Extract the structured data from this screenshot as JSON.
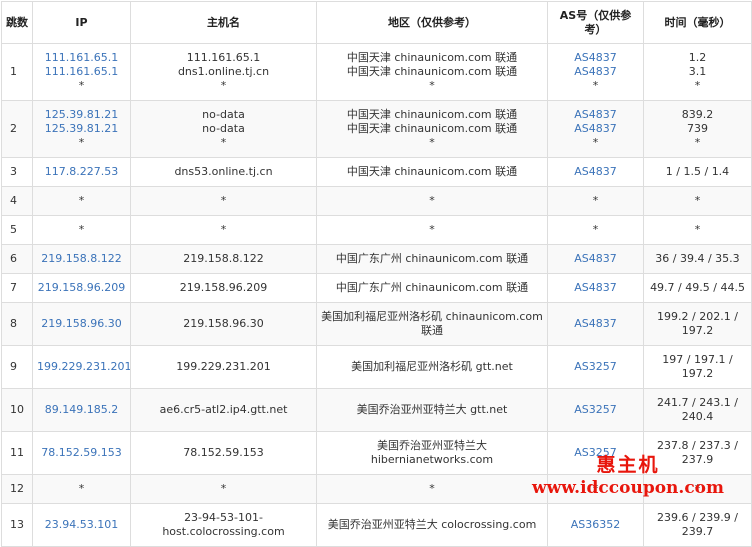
{
  "headers": {
    "hop": "跳数",
    "ip": "IP",
    "host": "主机名",
    "region": "地区（仅供参考）",
    "as": "AS号（仅供参考）",
    "time": "时间（毫秒）"
  },
  "rows": [
    {
      "hop": "1",
      "ip": [
        "111.161.65.1",
        "111.161.65.1",
        "*"
      ],
      "host": [
        "111.161.65.1",
        "dns1.online.tj.cn",
        "*"
      ],
      "region": [
        "中国天津 chinaunicom.com 联通",
        "中国天津 chinaunicom.com 联通",
        "*"
      ],
      "as": [
        "AS4837",
        "AS4837",
        "*"
      ],
      "time": [
        "1.2",
        "3.1",
        "*"
      ]
    },
    {
      "hop": "2",
      "ip": [
        "125.39.81.21",
        "125.39.81.21",
        "*"
      ],
      "host": [
        "no-data",
        "no-data",
        "*"
      ],
      "region": [
        "中国天津 chinaunicom.com 联通",
        "中国天津 chinaunicom.com 联通",
        "*"
      ],
      "as": [
        "AS4837",
        "AS4837",
        "*"
      ],
      "time": [
        "839.2",
        "739",
        "*"
      ]
    },
    {
      "hop": "3",
      "ip": [
        "117.8.227.53"
      ],
      "host": [
        "dns53.online.tj.cn"
      ],
      "region": [
        "中国天津 chinaunicom.com 联通"
      ],
      "as": [
        "AS4837"
      ],
      "time": [
        "1 / 1.5 / 1.4"
      ]
    },
    {
      "hop": "4",
      "ip": [
        "*"
      ],
      "host": [
        "*"
      ],
      "region": [
        "*"
      ],
      "as": [
        "*"
      ],
      "time": [
        "*"
      ]
    },
    {
      "hop": "5",
      "ip": [
        "*"
      ],
      "host": [
        "*"
      ],
      "region": [
        "*"
      ],
      "as": [
        "*"
      ],
      "time": [
        "*"
      ]
    },
    {
      "hop": "6",
      "ip": [
        "219.158.8.122"
      ],
      "host": [
        "219.158.8.122"
      ],
      "region": [
        "中国广东广州 chinaunicom.com 联通"
      ],
      "as": [
        "AS4837"
      ],
      "time": [
        "36 / 39.4 / 35.3"
      ]
    },
    {
      "hop": "7",
      "ip": [
        "219.158.96.209"
      ],
      "host": [
        "219.158.96.209"
      ],
      "region": [
        "中国广东广州 chinaunicom.com 联通"
      ],
      "as": [
        "AS4837"
      ],
      "time": [
        "49.7 / 49.5 / 44.5"
      ]
    },
    {
      "hop": "8",
      "ip": [
        "219.158.96.30"
      ],
      "host": [
        "219.158.96.30"
      ],
      "region": [
        "美国加利福尼亚州洛杉矶 chinaunicom.com",
        "联通"
      ],
      "as": [
        "AS4837"
      ],
      "time": [
        "199.2 / 202.1 /",
        "197.2"
      ]
    },
    {
      "hop": "9",
      "ip": [
        "199.229.231.201"
      ],
      "host": [
        "199.229.231.201"
      ],
      "region": [
        "美国加利福尼亚州洛杉矶 gtt.net"
      ],
      "as": [
        "AS3257"
      ],
      "time": [
        "197 / 197.1 /",
        "197.2"
      ]
    },
    {
      "hop": "10",
      "ip": [
        "89.149.185.2"
      ],
      "host": [
        "ae6.cr5-atl2.ip4.gtt.net"
      ],
      "region": [
        "美国乔治亚州亚特兰大 gtt.net"
      ],
      "as": [
        "AS3257"
      ],
      "time": [
        "241.7 / 243.1 /",
        "240.4"
      ]
    },
    {
      "hop": "11",
      "ip": [
        "78.152.59.153"
      ],
      "host": [
        "78.152.59.153"
      ],
      "region": [
        "美国乔治亚州亚特兰大",
        "hibernianetworks.com"
      ],
      "as": [
        "AS3257"
      ],
      "time": [
        "237.8 / 237.3 /",
        "237.9"
      ]
    },
    {
      "hop": "12",
      "ip": [
        "*"
      ],
      "host": [
        "*"
      ],
      "region": [
        "*"
      ],
      "as": [
        "*"
      ],
      "time": [
        "*"
      ]
    },
    {
      "hop": "13",
      "ip": [
        "23.94.53.101"
      ],
      "host": [
        "23-94-53-101-",
        "host.colocrossing.com"
      ],
      "region": [
        "美国乔治亚州亚特兰大 colocrossing.com"
      ],
      "as": [
        "AS36352"
      ],
      "time": [
        "239.6 / 239.9 /",
        "239.7"
      ]
    }
  ],
  "watermark": {
    "brand": "惠主机",
    "url": "www.idccoupon.com"
  },
  "colors": {
    "link": "#3b73b9",
    "border": "#dddddd",
    "watermark": "#e8160c"
  }
}
